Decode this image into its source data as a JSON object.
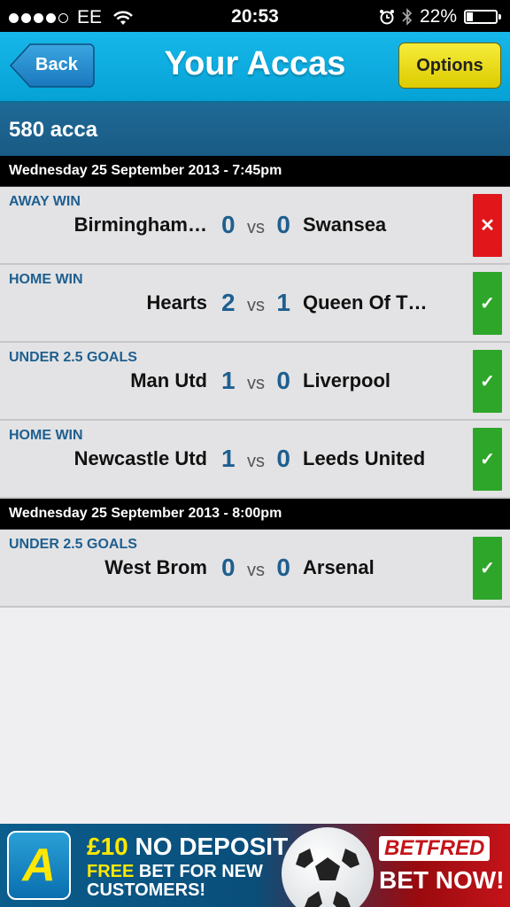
{
  "status_bar": {
    "carrier": "EE",
    "time": "20:53",
    "battery": "22%",
    "battery_level": 0.22
  },
  "header": {
    "back_label": "Back",
    "title": "Your Accas",
    "options_label": "Options"
  },
  "acca": {
    "name": "580 acca"
  },
  "groups": [
    {
      "date": "Wednesday 25 September 2013 - 7:45pm"
    },
    {
      "date": "Wednesday 25 September 2013 - 8:00pm"
    }
  ],
  "matches": [
    {
      "bet": "AWAY WIN",
      "home": "Birmingham…",
      "home_score": "0",
      "vs": "vs",
      "away_score": "0",
      "away": "Swansea",
      "result": "lost",
      "result_icon": "✕"
    },
    {
      "bet": "HOME WIN",
      "home": "Hearts",
      "home_score": "2",
      "vs": "vs",
      "away_score": "1",
      "away": "Queen Of T…",
      "result": "won",
      "result_icon": "✓"
    },
    {
      "bet": "UNDER 2.5 GOALS",
      "home": "Man Utd",
      "home_score": "1",
      "vs": "vs",
      "away_score": "0",
      "away": "Liverpool",
      "result": "won",
      "result_icon": "✓"
    },
    {
      "bet": "HOME WIN",
      "home": "Newcastle Utd",
      "home_score": "1",
      "vs": "vs",
      "away_score": "0",
      "away": "Leeds United",
      "result": "won",
      "result_icon": "✓"
    },
    {
      "bet": "UNDER 2.5 GOALS",
      "home": "West Brom",
      "home_score": "0",
      "vs": "vs",
      "away_score": "0",
      "away": "Arsenal",
      "result": "won",
      "result_icon": "✓"
    }
  ],
  "ad": {
    "logo_letter": "A",
    "money": "£10",
    "headline": " NO DEPOSIT",
    "free": "FREE",
    "line2": " BET FOR NEW",
    "line3": "CUSTOMERS!",
    "brand": "BETFRED",
    "cta": "BET NOW!"
  },
  "colors": {
    "header": "#06a2d6",
    "acca_bar": "#1f6a97",
    "accent_text": "#1e5f8f",
    "won": "#2ea62a",
    "lost": "#e0161b",
    "options": "#f0e12a"
  }
}
